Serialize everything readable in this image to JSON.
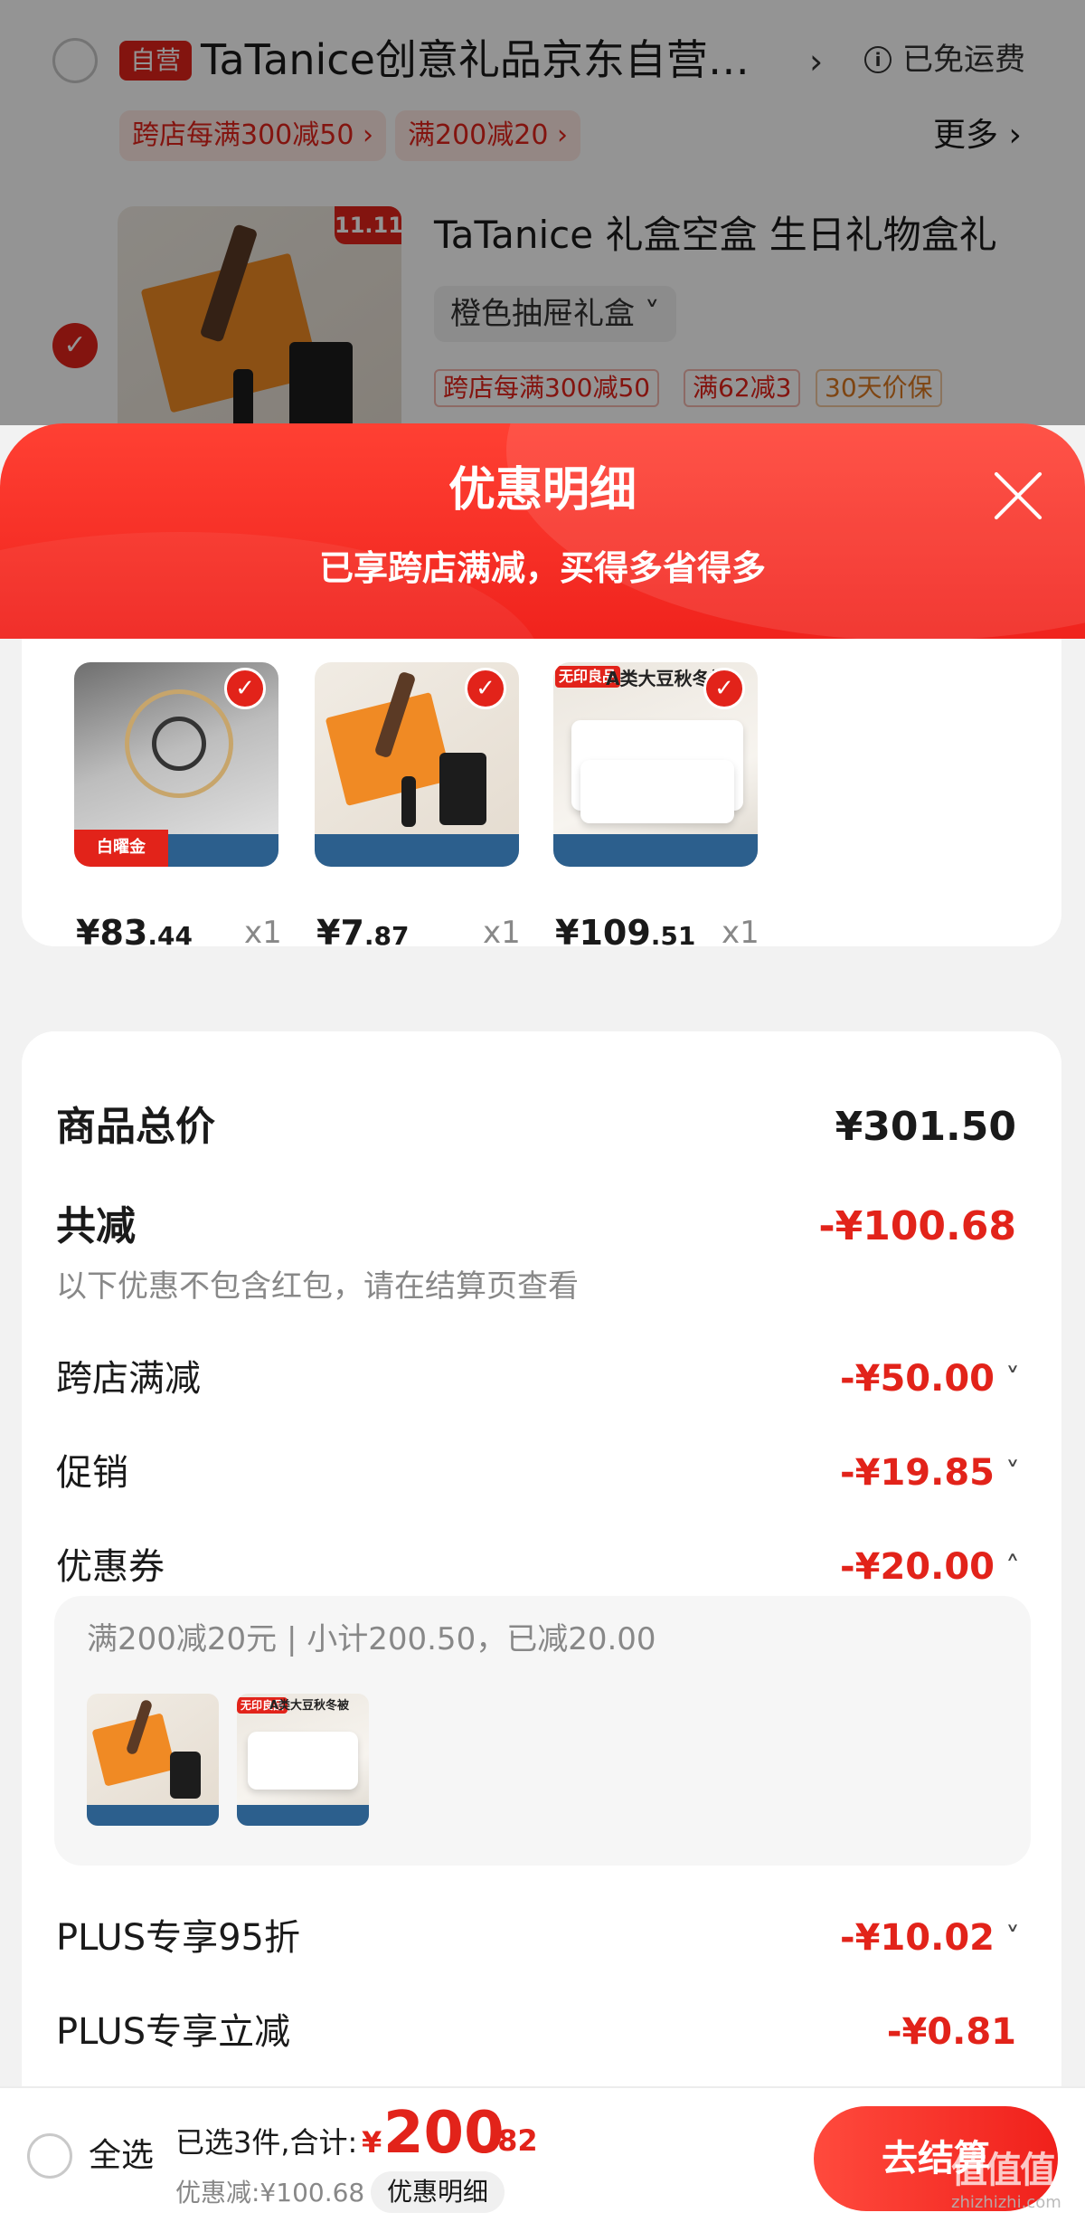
{
  "background": {
    "shop": {
      "self_operated_tag": "自营",
      "name": "TaTanice创意礼品京东自营…",
      "chevron": "›",
      "info_icon": "i",
      "shipping": "已免运费",
      "promotions": [
        "跨店每满300减50 ›",
        "满200减20 ›"
      ],
      "more": "更多 ›"
    },
    "item": {
      "badge": "11.11",
      "title": "TaTanice 礼盒空盒 生日礼物盒礼",
      "spec": "橙色抽屉礼盒 ˅",
      "tags": [
        "跨店每满300减50",
        "满62减3",
        "30天价保"
      ]
    }
  },
  "sheet": {
    "title": "优惠明细",
    "subtitle": "已享跨店满减，买得多省得多",
    "items": [
      {
        "image": "towel-rack-product",
        "badge_text": "白曜金",
        "price_int": "¥83",
        "price_dec": ".44",
        "qty": "x1"
      },
      {
        "image": "gift-box-product",
        "price_int": "¥7",
        "price_dec": ".87",
        "qty": "x1"
      },
      {
        "image": "quilt-product",
        "label_text": "无印良品",
        "title_text": "A类大豆秋冬被",
        "price_int": "¥109",
        "price_dec": ".51",
        "qty": "x1"
      }
    ],
    "summary": {
      "total_label": "商品总价",
      "total_value": "¥301.50",
      "reduce_label": "共减",
      "reduce_value": "-¥100.68",
      "note": "以下优惠不包含红包，请在结算页查看",
      "rows": [
        {
          "label": "跨店满减",
          "value": "-¥50.00",
          "chevron": "˅"
        },
        {
          "label": "促销",
          "value": "-¥19.85",
          "chevron": "˅"
        },
        {
          "label": "优惠券",
          "value": "-¥20.00",
          "chevron": "˄"
        }
      ],
      "coupon_detail": "满200减20元 | 小计200.50，已减20.00",
      "plus_rows": [
        {
          "label": "PLUS专享95折",
          "value": "-¥10.02",
          "chevron": "˅"
        },
        {
          "label": "PLUS专享立减",
          "value": "-¥0.81"
        }
      ]
    }
  },
  "bottom_bar": {
    "select_all": "全选",
    "selected_text": "已选3件,合计:",
    "yen": "¥",
    "total_int": "200",
    "total_dec": ".82",
    "discount_text": "优惠减:¥100.68",
    "detail_button": "优惠明细",
    "checkout_button": "去结算"
  },
  "watermark": {
    "text": "值值值",
    "url": "zhizhizhi.com"
  },
  "colors": {
    "accent": "#e2231a",
    "sheet_header": "#f0231d",
    "muted_text": "#888888"
  }
}
